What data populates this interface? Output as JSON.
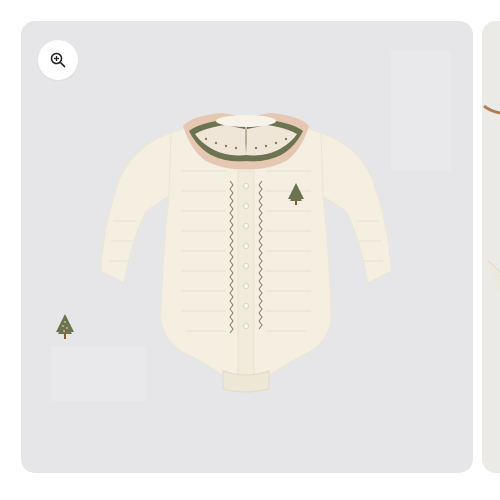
{
  "gallery": {
    "zoom_button": {
      "icon": "zoom-in-icon"
    },
    "main_slide": {
      "image": "baby-bodysuit-photo",
      "background": "#e6e6e9",
      "garment_color": "#f4efe1",
      "collar_trim_color": "#e6c7b2",
      "embroidery_color": "#6b7350"
    },
    "next_slide": {
      "image": "product-photo-partial"
    }
  }
}
